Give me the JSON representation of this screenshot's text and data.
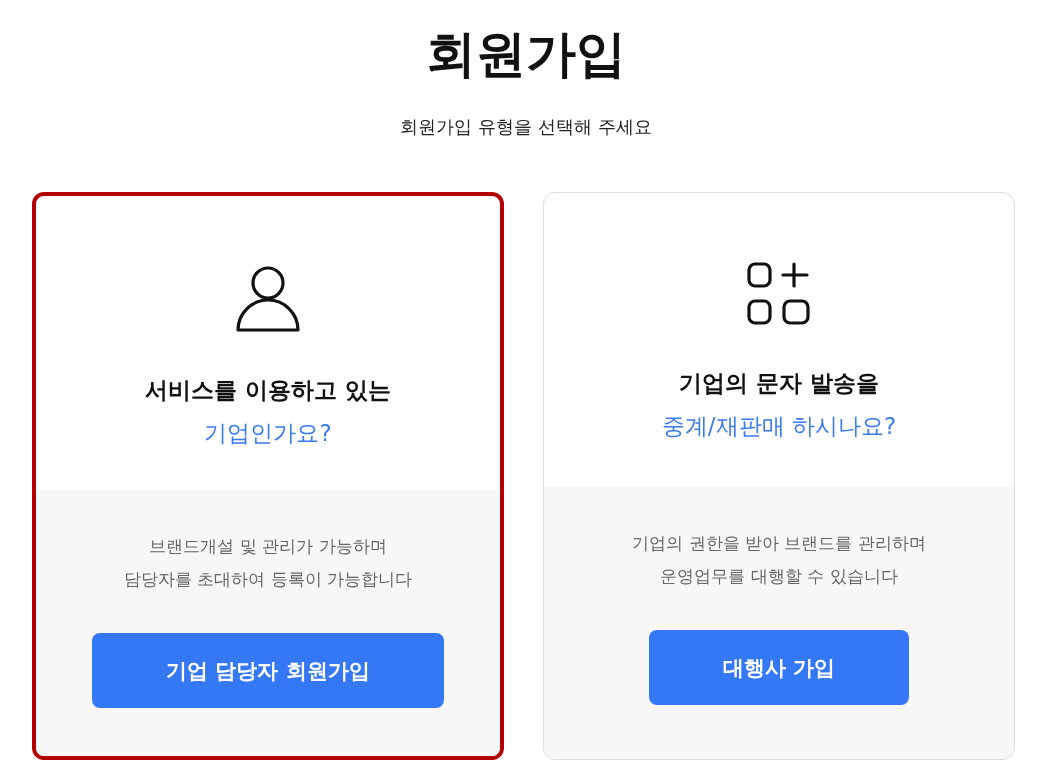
{
  "title": "회원가입",
  "subtitle": "회원가입 유형을 선택해 주세요",
  "cards": [
    {
      "selected": true,
      "heading": "서비스를 이용하고 있는",
      "question": "기업인가요?",
      "description": [
        "브랜드개설 및 관리가 가능하며",
        "담당자를 초대하여 등록이 가능합니다"
      ],
      "button": "기업 담당자 회원가입"
    },
    {
      "selected": false,
      "heading": "기업의 문자 발송을",
      "question": "중계/재판매 하시나요?",
      "description": [
        "기업의 권한을 받아 브랜드를 관리하며",
        "운영업무를 대행할 수 있습니다"
      ],
      "button": "대행사 가입"
    }
  ]
}
